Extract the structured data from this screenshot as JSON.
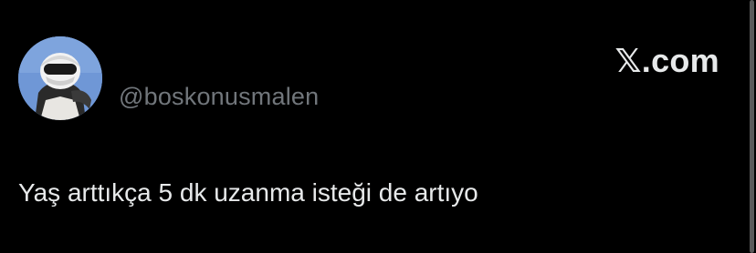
{
  "tweet": {
    "handle": "@boskonusmalen",
    "brand": "𝕏.com",
    "text": "Yaş arttıkça 5 dk uzanma isteği de artıyo"
  },
  "colors": {
    "background": "#000000",
    "text": "#e7e9ea",
    "secondary_text": "#71767b",
    "avatar_sky": "#6f97d6"
  },
  "icons": {
    "avatar": "profile-photo-helmet-figure"
  }
}
